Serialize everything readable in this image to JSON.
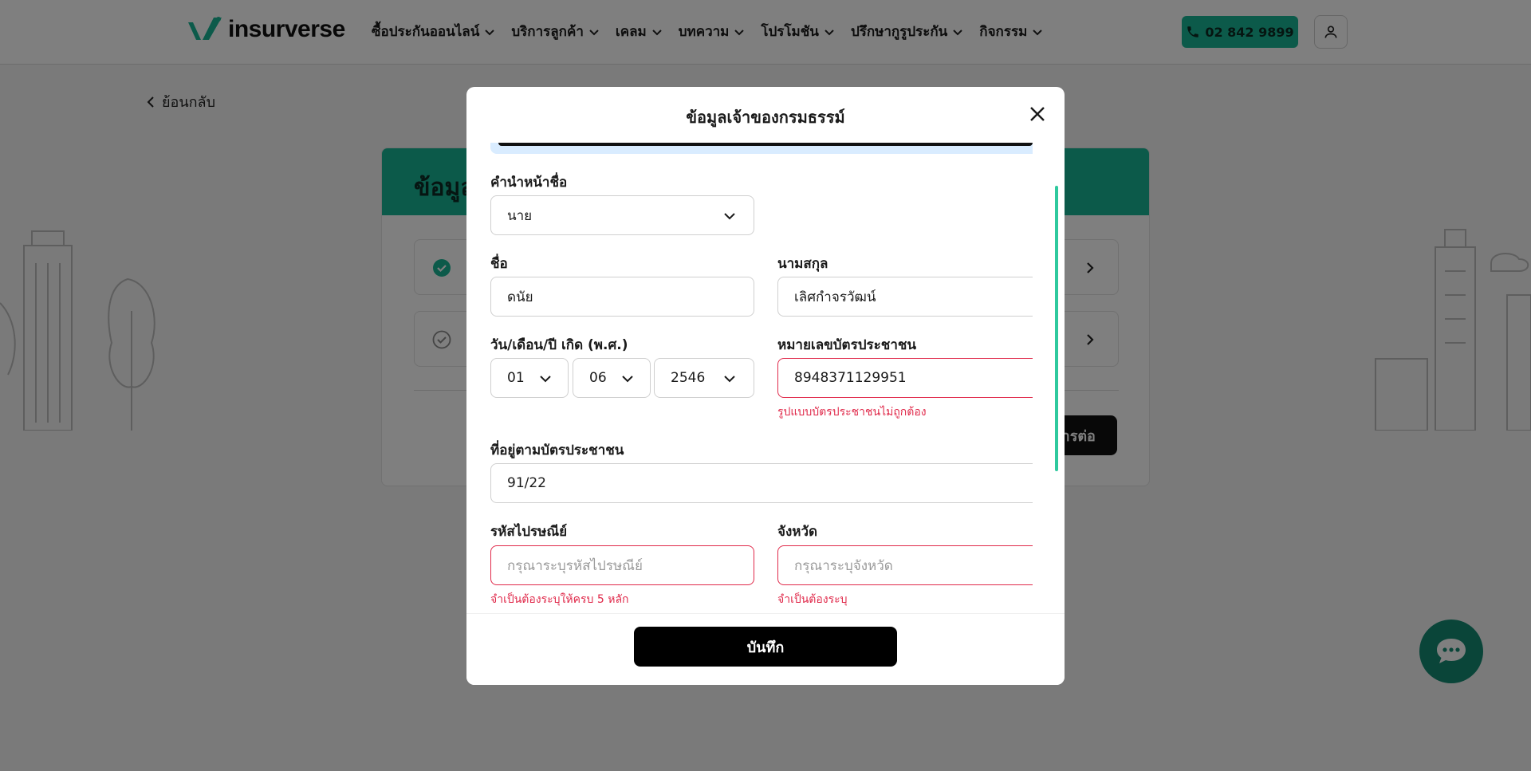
{
  "header": {
    "brand": "insurverse",
    "nav": [
      {
        "label": "ซื้อประกันออนไลน์"
      },
      {
        "label": "บริการลูกค้า"
      },
      {
        "label": "เคลม"
      },
      {
        "label": "บทความ"
      },
      {
        "label": "โปรโมชัน"
      },
      {
        "label": "ปรึกษากูรูประกัน"
      },
      {
        "label": "กิจกรรม"
      }
    ],
    "phone": "02 842 9899",
    "accent": "#18b594"
  },
  "page": {
    "back_label": "ย้อนกลับ",
    "card_title": "ข้อมูล",
    "continue_label": "ดำเนินการต่อ"
  },
  "modal": {
    "title": "ข้อมูลเจ้าของกรมธรรม์",
    "prefix": {
      "label": "คำนำหน้าชื่อ",
      "value": "นาย"
    },
    "first_name": {
      "label": "ชื่อ",
      "value": "ดนัย"
    },
    "last_name": {
      "label": "นามสกุล",
      "value": "เลิศกำจรวัฒน์"
    },
    "birth": {
      "label": "วัน/เดือน/ปี เกิด (พ.ศ.)",
      "day": "01",
      "month": "06",
      "year": "2546"
    },
    "id_card": {
      "label": "หมายเลขบัตรประชาชน",
      "value": "8948371129951",
      "error": "รูปแบบบัตรประชาชนไม่ถูกต้อง"
    },
    "address": {
      "label": "ที่อยู่ตามบัตรประชาชน",
      "value": "91/22"
    },
    "postcode": {
      "label": "รหัสไปรษณีย์",
      "placeholder": "กรุณาระบุรหัสไปรษณีย์",
      "error": "จำเป็นต้องระบุให้ครบ 5 หลัก"
    },
    "province": {
      "label": "จังหวัด",
      "placeholder": "กรุณาระบุจังหวัด",
      "error": "จำเป็นต้องระบุ"
    },
    "save_label": "บันทึก",
    "error_color": "#e0294a"
  }
}
